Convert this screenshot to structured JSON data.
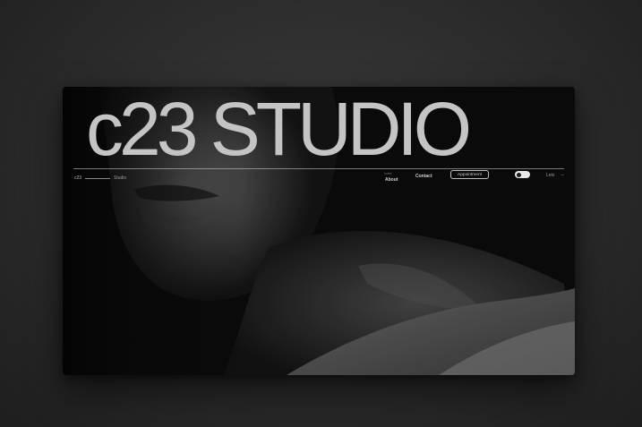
{
  "hero": {
    "title": "c23 STUDIO"
  },
  "nav": {
    "brand": "c23",
    "brand_sub": "Studio",
    "index_label": "Index",
    "about": "About",
    "contact": "Contact",
    "appointment": "Appointment",
    "lets": "Lets",
    "arrow": "→"
  },
  "theme": {
    "background": "#2b2b2b",
    "text": "#c4c4c4",
    "toggle": "#e9e9e9"
  },
  "icons": {
    "toggle": "theme-toggle-icon",
    "arrow": "arrow-right-icon"
  }
}
